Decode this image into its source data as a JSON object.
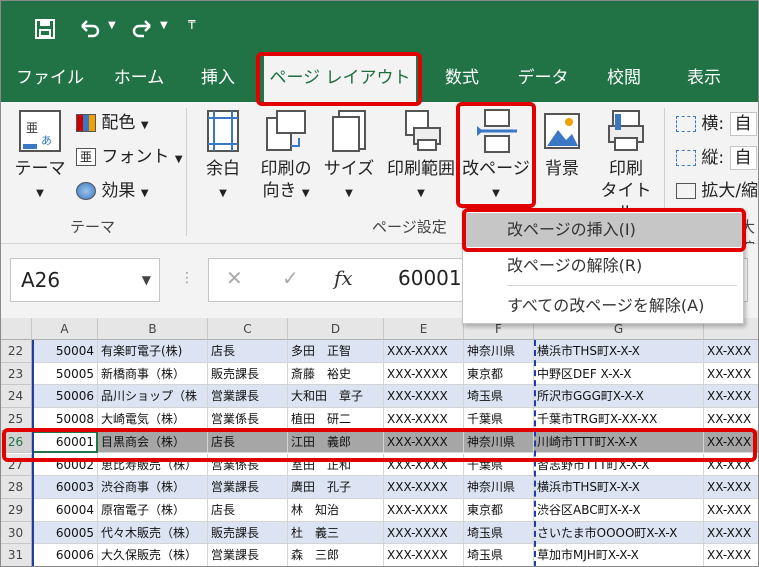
{
  "quick_access": {
    "save_icon": "save-icon",
    "undo_icon": "undo-icon",
    "redo_icon": "redo-icon",
    "customize_icon": "customize-icon"
  },
  "tabs": [
    {
      "label": "ファイル"
    },
    {
      "label": "ホーム"
    },
    {
      "label": "挿入"
    },
    {
      "label": "ページ レイアウト"
    },
    {
      "label": "数式"
    },
    {
      "label": "データ"
    },
    {
      "label": "校閲"
    },
    {
      "label": "表示"
    }
  ],
  "ribbon": {
    "theme_group": {
      "themes": "テーマ",
      "colors": "配色",
      "fonts": "フォント",
      "effects": "効果",
      "label": "テーマ"
    },
    "page_setup": {
      "margins": "余白",
      "orientation_1": "印刷の",
      "orientation_2": "向き",
      "size": "サイズ",
      "print_area": "印刷範囲",
      "breaks": "改ページ",
      "background": "背景",
      "print_titles_1": "印刷",
      "print_titles_2": "タイトル",
      "label": "ページ設定"
    },
    "scale": {
      "width": "横:",
      "width_value": "自",
      "height": "縦:",
      "height_value": "自",
      "scale": "拡大/縮",
      "cut_label": "大縮"
    }
  },
  "menu": {
    "insert_break": "改ページの挿入(I)",
    "remove_break": "改ページの解除(R)",
    "reset_all": "すべての改ページを解除(A)"
  },
  "formula_bar": {
    "name_box": "A26",
    "formula": "60001",
    "cancel": "✕",
    "enter": "✓",
    "fx": "fx"
  },
  "columns": [
    "A",
    "B",
    "C",
    "D",
    "E",
    "F",
    "G",
    ""
  ],
  "rows": [
    {
      "n": "22",
      "a": "50004",
      "b": "有楽町電子(株)",
      "c": "店長",
      "d": "多田　正智",
      "e": "XXX-XXXX",
      "f": "神奈川県",
      "g": "横浜市THS町X-X-X",
      "h": "XX-XXX"
    },
    {
      "n": "23",
      "a": "50005",
      "b": "新橋商事（株）",
      "c": "販売課長",
      "d": "斎藤　裕史",
      "e": "XXX-XXXX",
      "f": "東京都",
      "g": "中野区DEF X-X-X",
      "h": "XX-XXX"
    },
    {
      "n": "24",
      "a": "50006",
      "b": "品川ショップ（株",
      "c": "営業課長",
      "d": "大和田　章子",
      "e": "XXX-XXXX",
      "f": "埼玉県",
      "g": "所沢市GGG町X-X-X",
      "h": "XX-XXX"
    },
    {
      "n": "25",
      "a": "50008",
      "b": "大崎電気（株）",
      "c": "営業係長",
      "d": "植田　研二",
      "e": "XXX-XXXX",
      "f": "千葉県",
      "g": "千葉市TRG町X-XX-XX",
      "h": "XX-XXX"
    },
    {
      "n": "26",
      "a": "60001",
      "b": "目黒商会（株）",
      "c": "店長",
      "d": "江田　義郎",
      "e": "XXX-XXXX",
      "f": "神奈川県",
      "g": "川崎市TTT町X-X-X",
      "h": "XX-XXX"
    },
    {
      "n": "27",
      "a": "60002",
      "b": "恵比寿販売（株）",
      "c": "営業係長",
      "d": "室田　正和",
      "e": "XXX-XXXX",
      "f": "千葉県",
      "g": "習志野市TTT町X-X-X",
      "h": "XX-XXX"
    },
    {
      "n": "28",
      "a": "60003",
      "b": "渋谷商事（株）",
      "c": "営業課長",
      "d": "廣田　孔子",
      "e": "XXX-XXXX",
      "f": "神奈川県",
      "g": "横浜市THS町X-X-X",
      "h": "XX-XXX"
    },
    {
      "n": "29",
      "a": "60004",
      "b": "原宿電子（株）",
      "c": "店長",
      "d": "林　知治",
      "e": "XXX-XXXX",
      "f": "東京都",
      "g": "渋谷区ABC町X-X-X",
      "h": "XX-XXX"
    },
    {
      "n": "30",
      "a": "60005",
      "b": "代々木販売（株）",
      "c": "販売課長",
      "d": "杜　義三",
      "e": "XXX-XXXX",
      "f": "埼玉県",
      "g": "さいたま市OOOO町X-X-X",
      "h": "XX-XXX"
    },
    {
      "n": "31",
      "a": "60006",
      "b": "大久保販売（株）",
      "c": "営業課長",
      "d": "森　三郎",
      "e": "XXX-XXXX",
      "f": "埼玉県",
      "g": "草加市MJH町X-X-X",
      "h": "XX-XXX"
    }
  ],
  "colors": {
    "excel_green": "#217346",
    "highlight_red": "#e00000",
    "band": "#dce3f2",
    "selected": "#a6a6a6"
  }
}
